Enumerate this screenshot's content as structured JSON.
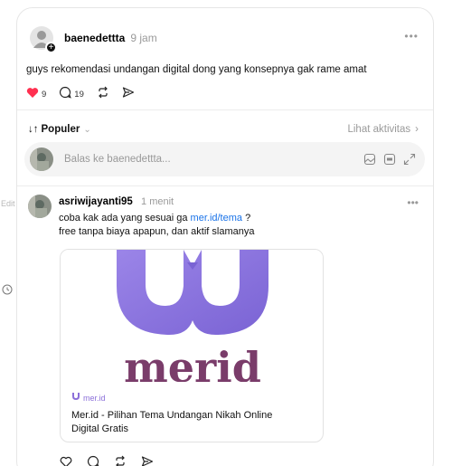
{
  "edge": {
    "edit_label": "Edit"
  },
  "post": {
    "username": "baenedettta",
    "time": "9 jam",
    "text": "guys rekomendasi undangan digital dong yang konsepnya gak rame amat",
    "likes": "9",
    "comments": "19"
  },
  "sort": {
    "label": "Populer",
    "activity": "Lihat aktivitas"
  },
  "reply_input": {
    "placeholder": "Balas ke baenedettta..."
  },
  "reply": {
    "username": "asriwijayanti95",
    "time": "1 menit",
    "line1_prefix": "coba kak ada yang sesuai ga ",
    "link": "mer.id/tema",
    "line1_suffix": " ?",
    "line2": "free tanpa biaya apapun, dan aktif slamanya"
  },
  "link_card": {
    "domain": "mer.id",
    "title": "Mer.id - Pilihan Tema Undangan Nikah Online Digital Gratis"
  },
  "colors": {
    "heart": "#ff3050",
    "link": "#1a73e8",
    "brand": "#8b6fd9"
  }
}
